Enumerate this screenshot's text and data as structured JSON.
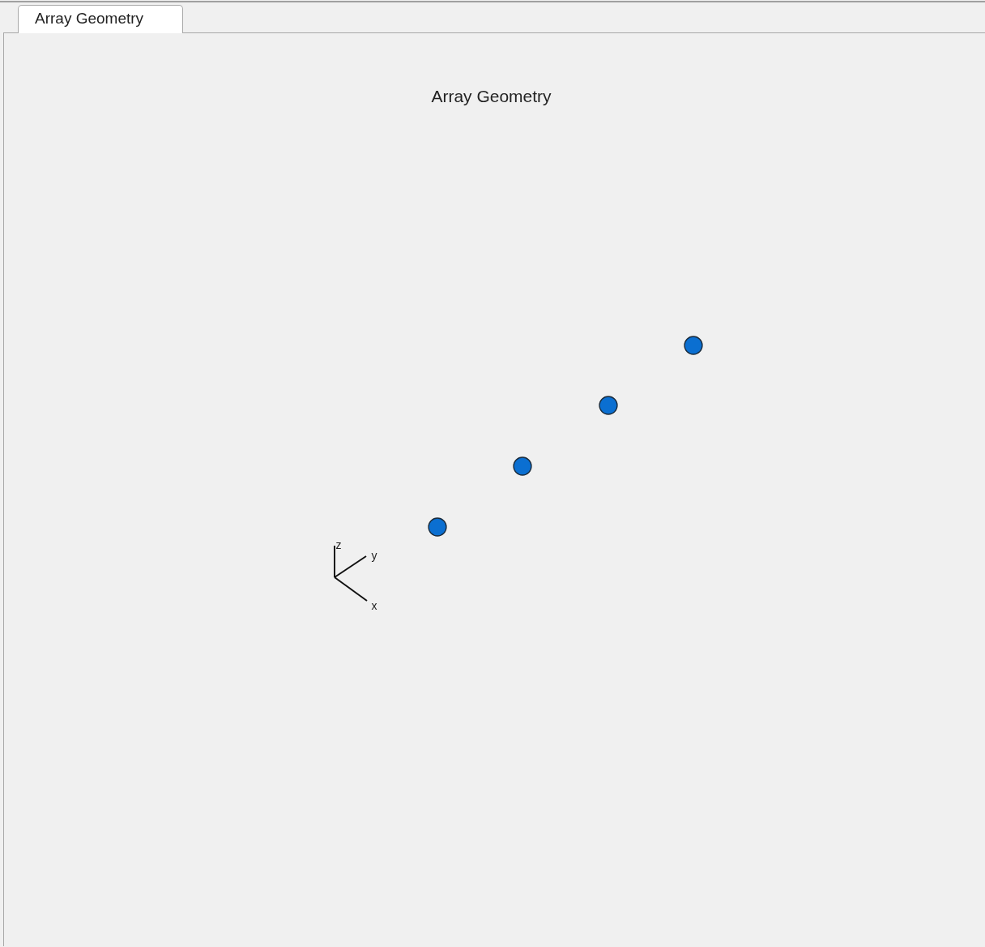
{
  "tabs": [
    {
      "label": "Array Geometry",
      "selected": true
    }
  ],
  "plot": {
    "title": "Array Geometry",
    "axes": [
      {
        "kind": "z",
        "label": "z"
      },
      {
        "kind": "y",
        "label": "y"
      },
      {
        "kind": "x",
        "label": "x"
      }
    ]
  }
}
